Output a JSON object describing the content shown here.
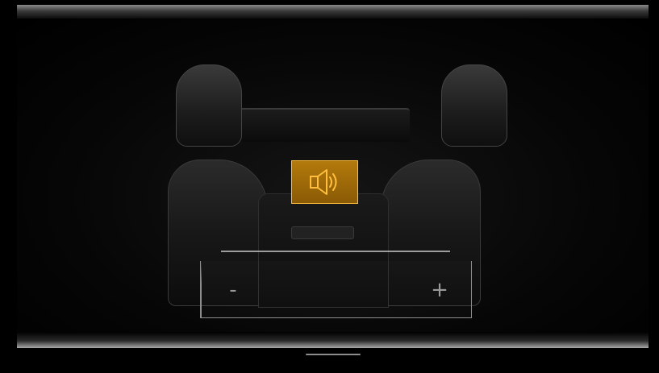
{
  "audio_button": {
    "icon": "speaker-volume-icon",
    "accent_color": "#ffbe3d"
  },
  "volume": {
    "minus_label": "-",
    "plus_label": "+"
  },
  "colors": {
    "background": "#000000",
    "accent": "#ffbe3d",
    "button_fill": "#9a650a",
    "control_line": "#9c9c9c"
  }
}
